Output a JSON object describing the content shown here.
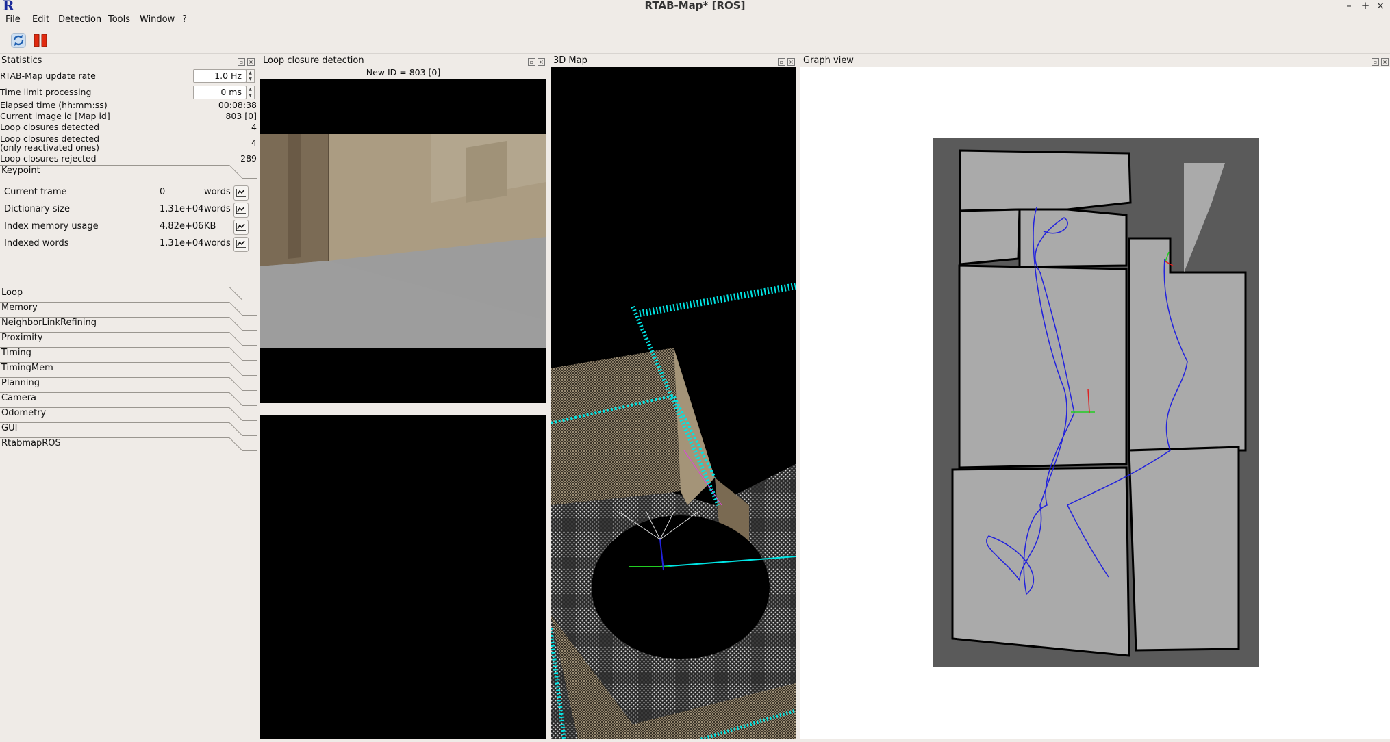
{
  "window": {
    "title": "RTAB-Map* [ROS]",
    "app_icon": "R",
    "minimize": "–",
    "maximize": "+",
    "close": "×"
  },
  "menu": [
    "File",
    "Edit",
    "Detection",
    "Tools",
    "Window",
    "?"
  ],
  "toolbar": {
    "icons": [
      "refresh-icon",
      "pause-icon"
    ]
  },
  "docks": {
    "statistics": "Statistics",
    "loop": "Loop closure detection",
    "map3d": "3D Map",
    "graph": "Graph view"
  },
  "loop_panel": {
    "new_id": "New ID = 803 [0]"
  },
  "stats": {
    "update_rate_label": "RTAB-Map update rate",
    "update_rate_value": "1.0 Hz",
    "time_limit_label": "Time limit processing",
    "time_limit_value": "0 ms",
    "rows": [
      {
        "label": "Elapsed time (hh:mm:ss)",
        "value": "00:08:38"
      },
      {
        "label": "Current image id [Map id]",
        "value": "803 [0]"
      },
      {
        "label": "Loop closures detected",
        "value": "4"
      },
      {
        "label": "Loop closures detected",
        "label2": "(only reactivated ones)",
        "value": "4"
      },
      {
        "label": "Loop closures rejected",
        "value": "289"
      }
    ]
  },
  "keypoint": {
    "title": "Keypoint",
    "rows": [
      {
        "name": "Current frame",
        "value": "0",
        "unit": "words"
      },
      {
        "name": "Dictionary size",
        "value": "1.31e+04",
        "unit": "words"
      },
      {
        "name": "Index memory usage",
        "value": "4.82e+06",
        "unit": "KB"
      },
      {
        "name": "Indexed words",
        "value": "1.31e+04",
        "unit": "words"
      }
    ]
  },
  "sections": [
    "Loop",
    "Memory",
    "NeighborLinkRefining",
    "Proximity",
    "Timing",
    "TimingMem",
    "Planning",
    "Camera",
    "Odometry",
    "GUI",
    "RtabmapROS"
  ],
  "colors": {
    "background": "#efebe7",
    "map_free": "#aaaaaa",
    "map_unknown": "#5a5a5a",
    "path": "#2222dd",
    "cloud": "#00e5e5"
  }
}
